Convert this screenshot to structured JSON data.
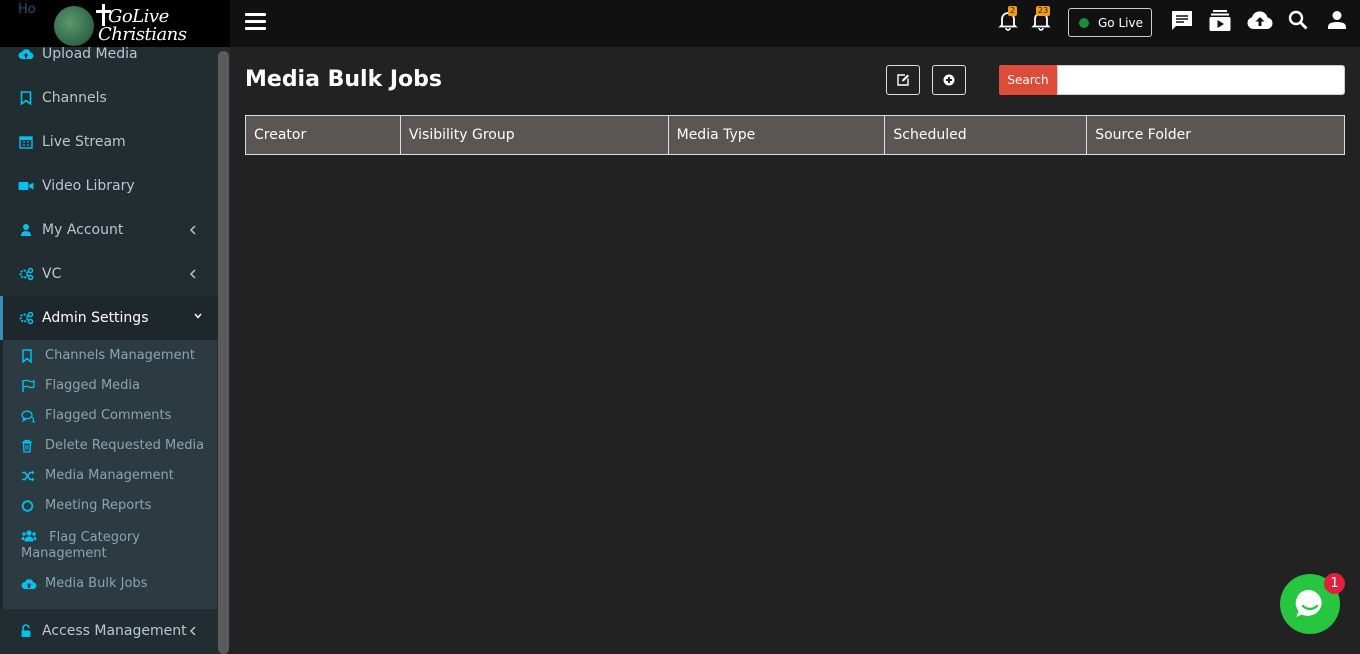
{
  "app": {
    "logo_line1": "GoLive",
    "logo_line2": "Christians",
    "hidden_first_item": "Ho"
  },
  "sidebar": {
    "items": [
      {
        "label": "Upload Media",
        "icon": "cloud-upload-icon"
      },
      {
        "label": "Channels",
        "icon": "bookmark-icon"
      },
      {
        "label": "Live Stream",
        "icon": "calendar-icon"
      },
      {
        "label": "Video Library",
        "icon": "video-camera-icon"
      },
      {
        "label": "My Account",
        "icon": "user-icon"
      },
      {
        "label": "VC",
        "icon": "cogs-icon"
      },
      {
        "label": "Admin Settings",
        "icon": "cogs-icon"
      }
    ],
    "submenu": [
      {
        "label": "Channels Management",
        "icon": "bookmark-outline-icon"
      },
      {
        "label": "Flagged Media",
        "icon": "flag-icon"
      },
      {
        "label": "Flagged Comments",
        "icon": "comments-icon"
      },
      {
        "label": "Delete Requested Media",
        "icon": "trash-icon"
      },
      {
        "label": "Media Management",
        "icon": "random-icon"
      },
      {
        "label": "Meeting Reports",
        "icon": "circle-icon"
      },
      {
        "label": "Flag Category Management",
        "icon": "users-icon"
      },
      {
        "label": "Media Bulk Jobs",
        "icon": "cloud-upload-icon"
      }
    ],
    "bottom_item": {
      "label": "Access Management",
      "icon": "lock-icon"
    }
  },
  "topbar": {
    "notif_count_1": "2",
    "notif_count_2": "23",
    "go_live_label": "Go Live"
  },
  "main": {
    "title": "Media Bulk Jobs",
    "search_label": "Search",
    "search_placeholder": "",
    "columns": [
      "Creator",
      "Visibility Group",
      "Media Type",
      "Scheduled",
      "Source Folder"
    ]
  },
  "chat": {
    "unread": "1"
  },
  "colors": {
    "accent": "#3c8dbc",
    "icon_blue": "#00c0ef",
    "search_red": "#dd4b39",
    "chat_green": "#27c540",
    "badge_orange": "#f39c12"
  }
}
